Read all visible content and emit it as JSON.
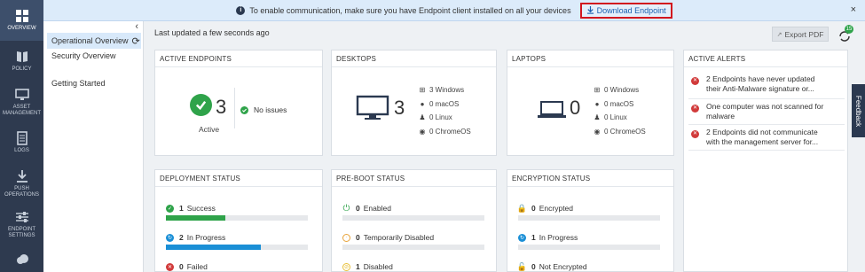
{
  "rail": [
    {
      "label": "OVERVIEW",
      "icon": "grid-icon",
      "active": true
    },
    {
      "label": "POLICY",
      "icon": "book-icon"
    },
    {
      "label": "ASSET MANAGEMENT",
      "icon": "monitor-icon"
    },
    {
      "label": "LOGS",
      "icon": "log-icon"
    },
    {
      "label": "PUSH OPERATIONS",
      "icon": "download-icon"
    },
    {
      "label": "ENDPOINT SETTINGS",
      "icon": "sliders-icon"
    }
  ],
  "banner": {
    "message": "To enable communication, make sure you have Endpoint client installed on all your devices",
    "button": "Download Endpoint",
    "close": "×"
  },
  "subnav": {
    "collapse": "‹",
    "items": [
      "Operational Overview",
      "Security Overview",
      "Getting Started"
    ]
  },
  "header": {
    "updated": "Last updated a few seconds ago",
    "export": "Export PDF",
    "notif_count": "15"
  },
  "active_endpoints": {
    "title": "ACTIVE ENDPOINTS",
    "count": "3",
    "label": "Active",
    "status": "No issues"
  },
  "desktops": {
    "title": "DESKTOPS",
    "count": "3",
    "os": [
      {
        "glyph": "⊞",
        "text": "3 Windows"
      },
      {
        "glyph": "",
        "text": "0 macOS"
      },
      {
        "glyph": "🐧",
        "text": "0 Linux"
      },
      {
        "glyph": "◉",
        "text": "0 ChromeOS"
      }
    ]
  },
  "laptops": {
    "title": "LAPTOPS",
    "count": "0",
    "os": [
      {
        "glyph": "⊞",
        "text": "0 Windows"
      },
      {
        "glyph": "",
        "text": "0 macOS"
      },
      {
        "glyph": "🐧",
        "text": "0 Linux"
      },
      {
        "glyph": "◉",
        "text": "0 ChromeOS"
      }
    ]
  },
  "alerts": {
    "title": "ACTIVE ALERTS",
    "items": [
      {
        "line1": "2 Endpoints have never updated",
        "line2": "their Anti-Malware signature or..."
      },
      {
        "line1": "One computer was not scanned for",
        "line2": "malware"
      },
      {
        "line1": "2 Endpoints did not communicate",
        "line2": "with the management server for..."
      }
    ]
  },
  "feedback": "Feedback",
  "deployment": {
    "title": "DEPLOYMENT STATUS",
    "rows": [
      {
        "count": "1",
        "label": "Success",
        "fraction": 0.42,
        "color": "#2fa34a"
      },
      {
        "count": "2",
        "label": "In Progress",
        "fraction": 0.67,
        "color": "#1a8fd6"
      },
      {
        "count": "0",
        "label": "Failed",
        "fraction": 0,
        "color": "#d13a3a"
      }
    ]
  },
  "preboot": {
    "title": "PRE-BOOT STATUS",
    "rows": [
      {
        "count": "0",
        "label": "Enabled"
      },
      {
        "count": "0",
        "label": "Temporarily Disabled"
      },
      {
        "count": "1",
        "label": "Disabled"
      }
    ]
  },
  "encryption": {
    "title": "ENCRYPTION STATUS",
    "rows": [
      {
        "count": "0",
        "label": "Encrypted"
      },
      {
        "count": "1",
        "label": "In Progress"
      },
      {
        "count": "0",
        "label": "Not Encrypted"
      }
    ]
  },
  "colors": {
    "brand_dark": "#2e3a4f",
    "success": "#2fa34a",
    "progress": "#1a8fd6",
    "error": "#d13a3a",
    "warning": "#e8a33a"
  }
}
